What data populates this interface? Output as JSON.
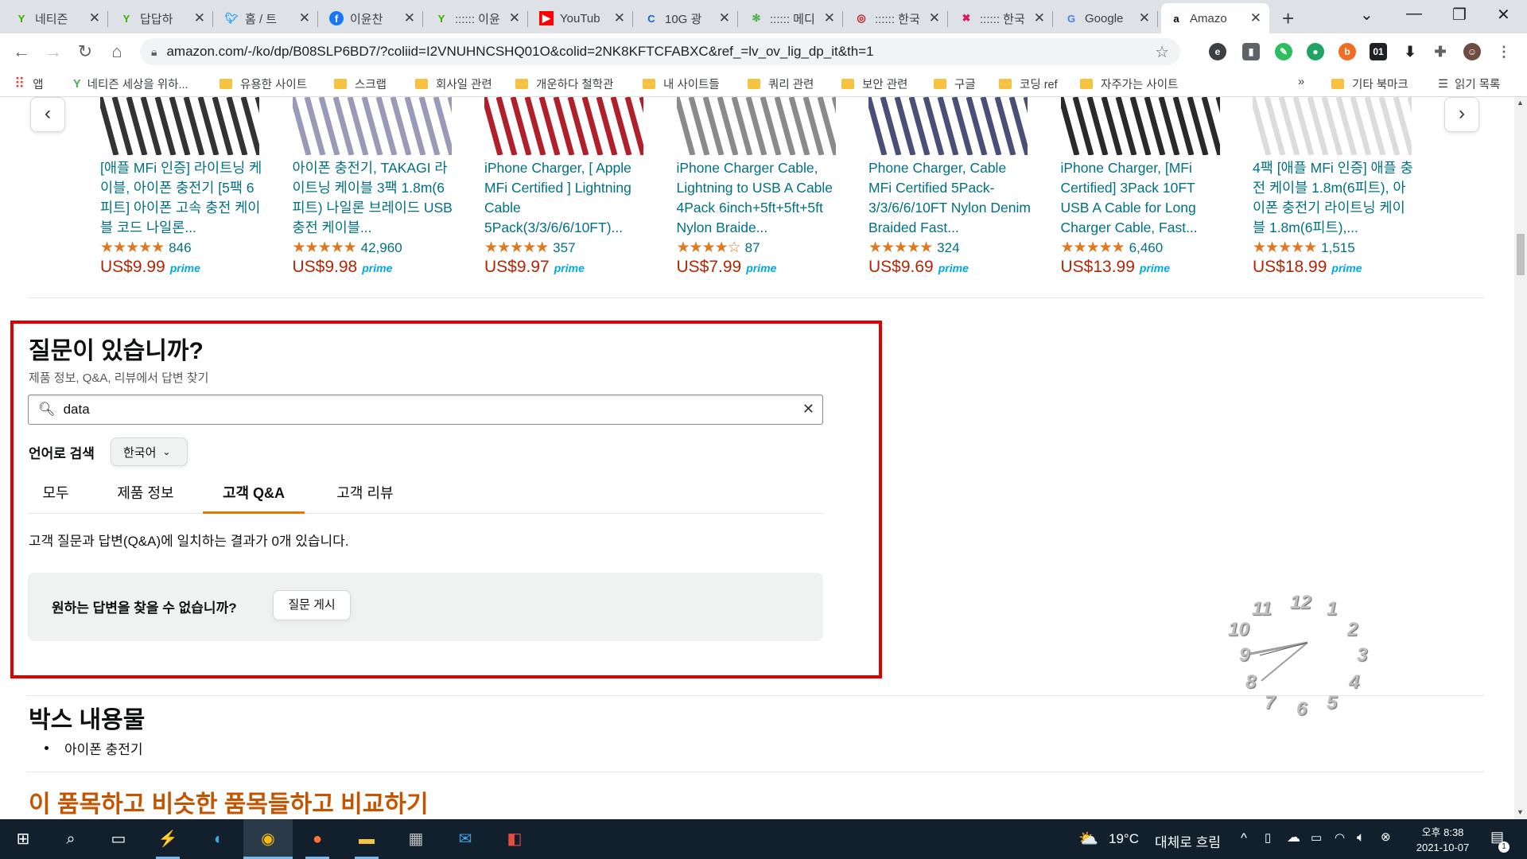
{
  "browser": {
    "tabs": [
      {
        "icon": "naver-sprout-icon",
        "title": "네티즌"
      },
      {
        "icon": "naver-sprout-icon",
        "title": "답답하"
      },
      {
        "icon": "twitter-icon",
        "title": "홈 / 트"
      },
      {
        "icon": "facebook-icon",
        "title": "이윤찬"
      },
      {
        "icon": "naver-sprout-icon",
        "title": ":::::: 이윤"
      },
      {
        "icon": "youtube-icon",
        "title": "YouTub"
      },
      {
        "icon": "c-logo-icon",
        "title": "10G 광"
      },
      {
        "icon": "pinwheel-icon",
        "title": ":::::: 메디"
      },
      {
        "icon": "seal-icon",
        "title": ":::::: 한국"
      },
      {
        "icon": "puzzle-logo-icon",
        "title": ":::::: 한국"
      },
      {
        "icon": "google-icon",
        "title": "Google"
      },
      {
        "icon": "amazon-icon",
        "title": "Amazo",
        "active": true
      }
    ],
    "url": "amazon.com/-/ko/dp/B08SLP6BD7/?coliid=I2VNUHNCSHQ01O&colid=2NK8KFTCFABXC&ref_=lv_ov_lig_dp_it&th=1",
    "bookmarks": [
      {
        "label": "앱",
        "icon": "apps-grid-icon"
      },
      {
        "label": "네티즌 세상을 위하...",
        "icon": "naver-sprout-icon"
      },
      {
        "label": "유용한 사이트",
        "icon": "folder-icon"
      },
      {
        "label": "스크랩",
        "icon": "folder-icon"
      },
      {
        "label": "회사일 관련",
        "icon": "folder-icon"
      },
      {
        "label": "개운하다 철학관",
        "icon": "folder-icon"
      },
      {
        "label": "내 사이트들",
        "icon": "folder-icon"
      },
      {
        "label": "쿼리 관련",
        "icon": "folder-icon"
      },
      {
        "label": "보안 관련",
        "icon": "folder-icon"
      },
      {
        "label": "구글",
        "icon": "folder-icon"
      },
      {
        "label": "코딩 ref",
        "icon": "folder-icon"
      },
      {
        "label": "자주가는 사이트",
        "icon": "folder-icon"
      }
    ],
    "bookmarks_more": "»",
    "other_bookmarks": "기타 북마크",
    "reading_list": "읽기 목록"
  },
  "products": [
    {
      "title": "[애플 MFi 인증] 라이트닝 케이블, 아이폰 충전기 [5팩 6피트] 아이폰 고속 충전 케이블 코드 나일론...",
      "stars": "★★★★★",
      "rating": 4.5,
      "reviews": "846",
      "price": "US$9.99",
      "prime": "prime",
      "color": "#333333"
    },
    {
      "title": "아이폰 충전기, TAKAGI 라이트닝 케이블 3팩 1.8m(6피트) 나일론 브레이드 USB 충전 케이블...",
      "stars": "★★★★★",
      "rating": 4.5,
      "reviews": "42,960",
      "price": "US$9.98",
      "prime": "prime",
      "color": "#9a9ab8"
    },
    {
      "title": "iPhone Charger, [ Apple MFi Certified ] Lightning Cable 5Pack(3/3/6/6/10FT)...",
      "stars": "★★★★★",
      "rating": 4.5,
      "reviews": "357",
      "price": "US$9.97",
      "prime": "prime",
      "color": "#b0202a"
    },
    {
      "title": "iPhone Charger Cable, Lightning to USB A Cable 4Pack 6inch+5ft+5ft+5ft Nylon Braide...",
      "stars": "★★★★☆",
      "rating": 4,
      "reviews": "87",
      "price": "US$7.99",
      "prime": "prime",
      "color": "#8a8a8a"
    },
    {
      "title": "Phone Charger, Cable MFi Certified 5Pack-3/3/6/6/10FT Nylon Denim Braided Fast...",
      "stars": "★★★★★",
      "rating": 4.5,
      "reviews": "324",
      "price": "US$9.69",
      "prime": "prime",
      "color": "#4a4f78"
    },
    {
      "title": "iPhone Charger, [MFi Certified] 3Pack 10FT USB A Cable for Long Charger Cable, Fast...",
      "stars": "★★★★★",
      "rating": 4.5,
      "reviews": "6,460",
      "price": "US$13.99",
      "prime": "prime",
      "color": "#2a2a2a"
    },
    {
      "title": "4팩 [애플 MFi 인증] 애플 충전 케이블 1.8m(6피트), 아이폰 충전기 라이트닝 케이블 1.8m(6피트),...",
      "stars": "★★★★★",
      "rating": 4.5,
      "reviews": "1,515",
      "price": "US$18.99",
      "prime": "prime",
      "color": "#dcdcdc"
    }
  ],
  "qa": {
    "title": "질문이 있습니까?",
    "subtitle": "제품 정보, Q&A, 리뷰에서 답변 찾기",
    "search_value": "data",
    "lang_label": "언어로 검색",
    "lang_value": "한국어",
    "tabs": [
      "모두",
      "제품 정보",
      "고객 Q&A",
      "고객 리뷰"
    ],
    "active_tab": "고객 Q&A",
    "result_text": "고객 질문과 답변(Q&A)에 일치하는 결과가 0개 있습니다.",
    "ask_prompt": "원하는 답변을 찾을 수 없습니까?",
    "ask_button": "질문 게시"
  },
  "box": {
    "title": "박스 내용물",
    "items": [
      "아이폰 충전기"
    ]
  },
  "compare_title": "이 품목하고 비슷한 품목들하고 비교하기",
  "clock_numbers": [
    "12",
    "1",
    "2",
    "3",
    "4",
    "5",
    "6",
    "7",
    "8",
    "9",
    "10",
    "11"
  ],
  "taskbar": {
    "weather_temp": "19°C",
    "weather_desc": "대체로 흐림",
    "time": "오후 8:38",
    "date": "2021-10-07",
    "notification_count": "1"
  },
  "colors": {
    "highlight_border": "#e00000",
    "link": "#007185",
    "price": "#b12704",
    "star": "#de7921",
    "compare_title": "#c45500"
  }
}
